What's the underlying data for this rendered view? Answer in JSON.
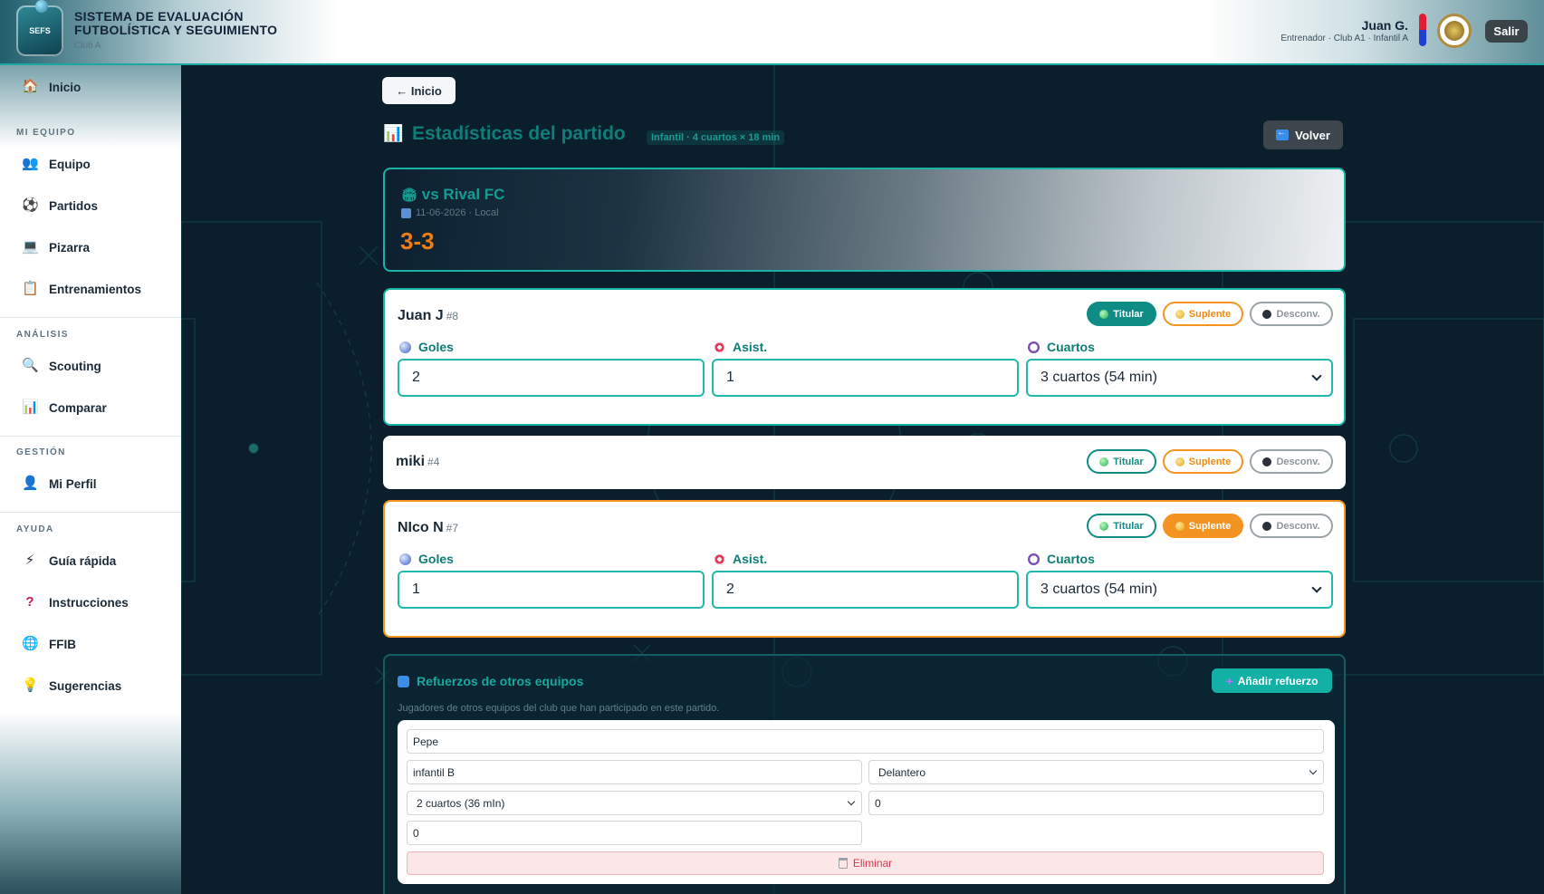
{
  "header": {
    "logo_text": "SEFS",
    "title": "SISTEMA DE EVALUACIÓN FUTBOLÍSTICA Y SEGUIMIENTO",
    "club": "Club A",
    "user_name": "Juan G.",
    "user_role": "Entrenador · Club A1 · Infantil A",
    "logout_label": "Salir",
    "colors": {
      "accent": "#1aa8a0",
      "club_red": "#e21d34",
      "club_blue": "#1e3fcf"
    }
  },
  "sidebar": {
    "home": {
      "label": "Inicio",
      "icon": "house-icon"
    },
    "sections": [
      {
        "title": "MI EQUIPO",
        "items": [
          {
            "label": "Equipo",
            "icon": "people-icon"
          },
          {
            "label": "Partidos",
            "icon": "soccer-ball-icon"
          },
          {
            "label": "Pizarra",
            "icon": "laptop-icon"
          },
          {
            "label": "Entrenamientos",
            "icon": "clipboard-icon"
          }
        ]
      },
      {
        "title": "ANÁLISIS",
        "items": [
          {
            "label": "Scouting",
            "icon": "magnifier-icon"
          },
          {
            "label": "Comparar",
            "icon": "bar-chart-icon"
          }
        ]
      },
      {
        "title": "GESTIÓN",
        "items": [
          {
            "label": "Mi Perfil",
            "icon": "user-icon"
          }
        ]
      },
      {
        "title": "AYUDA",
        "items": [
          {
            "label": "Guía rápida",
            "icon": "lightning-icon"
          },
          {
            "label": "Instrucciones",
            "icon": "question-icon"
          },
          {
            "label": "FFIB",
            "icon": "globe-icon"
          },
          {
            "label": "Sugerencias",
            "icon": "lightbulb-icon"
          }
        ]
      }
    ]
  },
  "main": {
    "home_button": "← Inicio",
    "title": "Estadísticas del partido",
    "format_badge": "Infantil · 4 cuartos × 18 min",
    "back_button": "Volver",
    "match": {
      "opponent": "vs Rival FC",
      "meta": "11-06-2026 · Local",
      "score": "3-3"
    },
    "status_labels": {
      "titular": "Titular",
      "suplente": "Suplente",
      "desconv": "Desconv."
    },
    "field_labels": {
      "goals": "Goles",
      "assists": "Asist.",
      "quarters": "Cuartos"
    },
    "players": [
      {
        "name": "Juan J",
        "number": "#8",
        "status": "titular",
        "goals": "2",
        "assists": "1",
        "quarters": "3 cuartos (54 min)"
      },
      {
        "name": "miki",
        "number": "#4",
        "status": "none"
      },
      {
        "name": "NIco N",
        "number": "#7",
        "status": "suplente",
        "goals": "1",
        "assists": "2",
        "quarters": "3 cuartos (54 min)"
      }
    ],
    "reinforcements": {
      "title": "Refuerzos de otros equipos",
      "add_button": "Añadir refuerzo",
      "description": "Jugadores de otros equipos del club que han participado en este partido.",
      "entry": {
        "name": "Pepe",
        "team": "infantil B",
        "position": "Delantero",
        "quarters": "2 cuartos (36 mIn)",
        "goals": "0",
        "assists": "0",
        "delete_label": "Eliminar"
      }
    }
  }
}
